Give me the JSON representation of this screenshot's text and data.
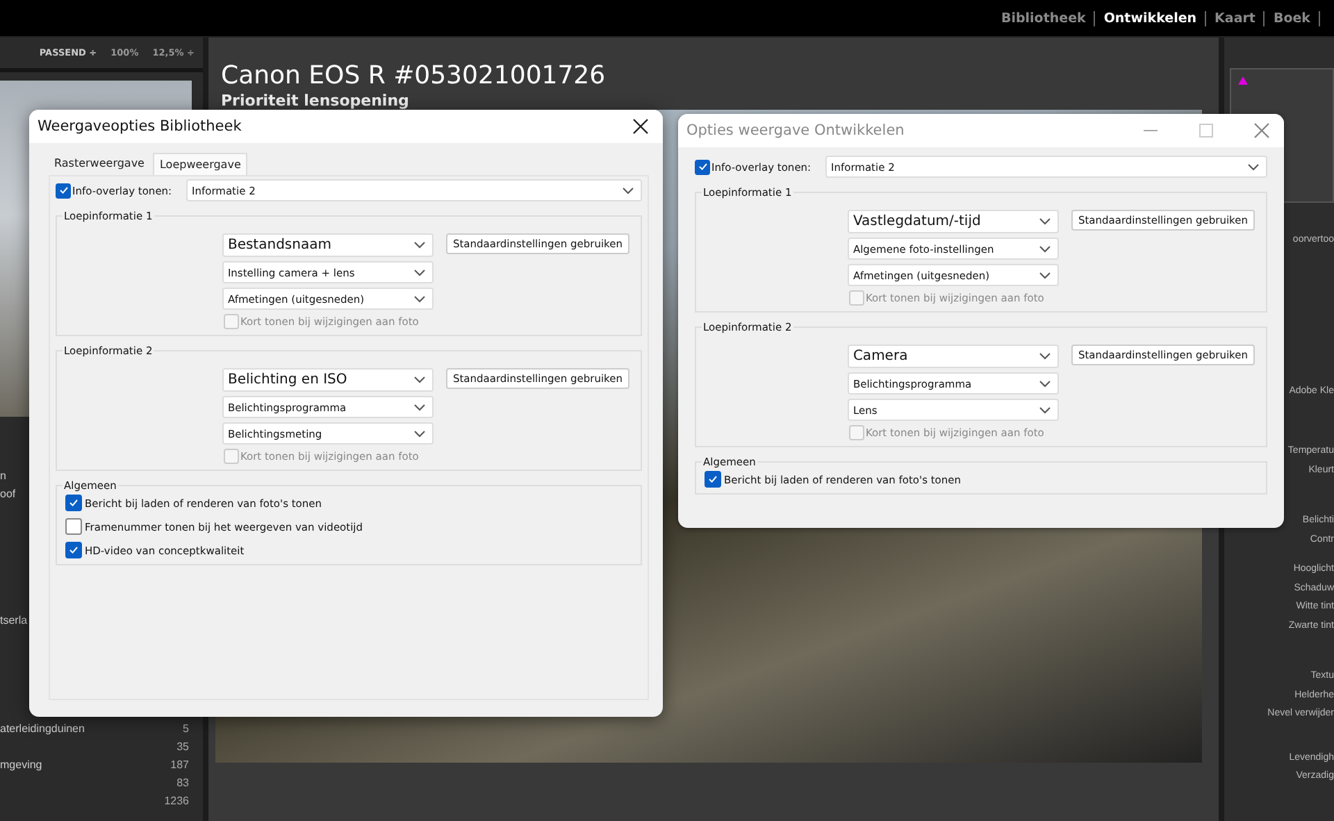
{
  "top_bar": {
    "modules": [
      {
        "label": "Bibliotheek",
        "selected": false
      },
      {
        "label": "Ontwikkelen",
        "selected": true
      },
      {
        "label": "Kaart",
        "selected": false
      },
      {
        "label": "Boek",
        "selected": false
      }
    ]
  },
  "left_panel": {
    "zoom_options": [
      "PASSEND ÷",
      "100%",
      "12,5% ÷"
    ],
    "rows": [
      {
        "name": "",
        "count": ""
      },
      {
        "name": "",
        "count": ""
      },
      {
        "name": "n",
        "count": ""
      },
      {
        "name": "oof",
        "count": ""
      },
      {
        "name": "",
        "count": ""
      },
      {
        "name": "",
        "count": ""
      },
      {
        "name": "",
        "count": ""
      },
      {
        "name": "",
        "count": ""
      },
      {
        "name": "",
        "count": ""
      },
      {
        "name": "",
        "count": ""
      },
      {
        "name": "tserla",
        "count": ""
      },
      {
        "name": "",
        "count": ""
      },
      {
        "name": "",
        "count": ""
      },
      {
        "name": "",
        "count": ""
      },
      {
        "name": "",
        "count": ""
      },
      {
        "name": "",
        "count": ""
      },
      {
        "name": "aterleidingduinen",
        "count": "5"
      },
      {
        "name": "",
        "count": "35"
      },
      {
        "name": "mgeving",
        "count": "187"
      },
      {
        "name": "",
        "count": "83"
      },
      {
        "name": "",
        "count": "1236"
      }
    ]
  },
  "photo_info": {
    "title": "Canon EOS R #053021001726",
    "subtitle": "Prioriteit lensopening"
  },
  "right_panel": {
    "labels": [
      "oorvertoo",
      "Adobe Kle",
      "Temperatu",
      "Kleurt",
      "Belichti",
      "Contr",
      "Hooglicht",
      "Schaduw",
      "Witte tint",
      "Zwarte tint",
      "Textu",
      "Helderhe",
      "Nevel verwijder",
      "Levendigh",
      "Verzadig"
    ]
  },
  "dialogs": [
    {
      "title": "Weergaveopties Bibliotheek",
      "active": true,
      "window_buttons": [
        {
          "kind": "close"
        }
      ],
      "tabs": [
        {
          "label": "Rasterweergave",
          "selected": false
        },
        {
          "label": "Loepweergave",
          "selected": true
        }
      ],
      "overlay": {
        "label": "Info-overlay tonen:",
        "checked": true,
        "value": "Informatie 2"
      },
      "groups": [
        {
          "title": "Loepinformatie 1",
          "selects": [
            {
              "value": "Bestandsnaam",
              "large": true
            },
            {
              "value": "Instelling camera + lens",
              "large": false
            },
            {
              "value": "Afmetingen (uitgesneden)",
              "large": false
            }
          ],
          "button": "Standaardinstellingen gebruiken",
          "flash": {
            "label": "Kort tonen bij wijzigingen aan foto",
            "checked": false,
            "disabled": true
          }
        },
        {
          "title": "Loepinformatie 2",
          "selects": [
            {
              "value": "Belichting en ISO",
              "large": true
            },
            {
              "value": "Belichtingsprogramma",
              "large": false
            },
            {
              "value": "Belichtingsmeting",
              "large": false
            }
          ],
          "button": "Standaardinstellingen gebruiken",
          "flash": {
            "label": "Kort tonen bij wijzigingen aan foto",
            "checked": false,
            "disabled": true
          }
        }
      ],
      "general": {
        "title": "Algemeen",
        "options": [
          {
            "label": "Bericht bij laden of renderen van foto's tonen",
            "checked": true
          },
          {
            "label": "Framenummer tonen bij het weergeven van videotijd",
            "checked": false
          },
          {
            "label": "HD-video van conceptkwaliteit",
            "checked": true
          }
        ]
      }
    },
    {
      "title": "Opties weergave Ontwikkelen",
      "active": false,
      "window_buttons": [
        {
          "kind": "minimize"
        },
        {
          "kind": "maximize"
        },
        {
          "kind": "close"
        }
      ],
      "overlay": {
        "label": "Info-overlay tonen:",
        "checked": true,
        "value": "Informatie 2"
      },
      "groups": [
        {
          "title": "Loepinformatie 1",
          "selects": [
            {
              "value": "Vastlegdatum/-tijd",
              "large": true
            },
            {
              "value": "Algemene foto-instellingen",
              "large": false
            },
            {
              "value": "Afmetingen (uitgesneden)",
              "large": false
            }
          ],
          "button": "Standaardinstellingen gebruiken",
          "flash": {
            "label": "Kort tonen bij wijzigingen aan foto",
            "checked": false,
            "disabled": true
          }
        },
        {
          "title": "Loepinformatie 2",
          "selects": [
            {
              "value": "Camera",
              "large": true
            },
            {
              "value": "Belichtingsprogramma",
              "large": false
            },
            {
              "value": "Lens",
              "large": false
            }
          ],
          "button": "Standaardinstellingen gebruiken",
          "flash": {
            "label": "Kort tonen bij wijzigingen aan foto",
            "checked": false,
            "disabled": true
          }
        }
      ],
      "general": {
        "title": "Algemeen",
        "options": [
          {
            "label": "Bericht bij laden of renderen van foto's tonen",
            "checked": true
          }
        ]
      }
    }
  ]
}
